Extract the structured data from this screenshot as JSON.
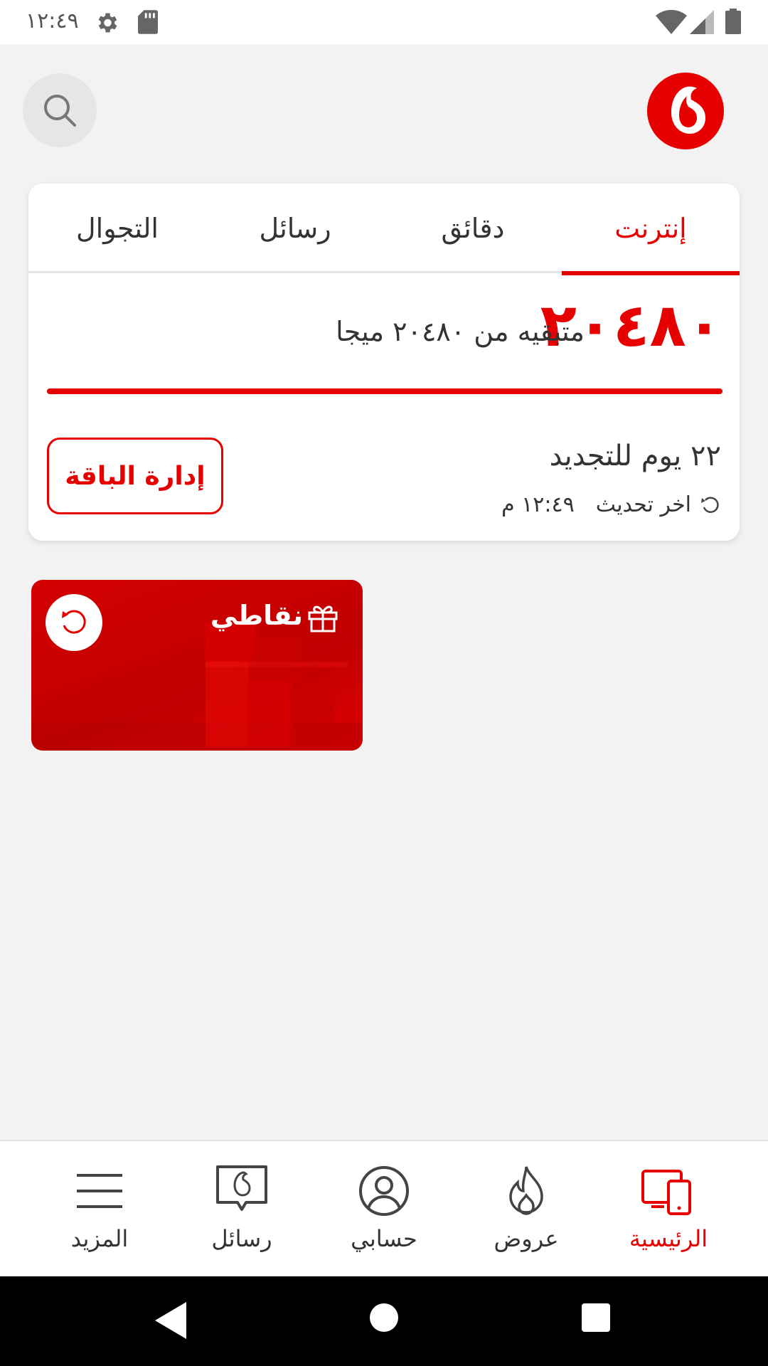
{
  "status_bar": {
    "time": "١٢:٤٩"
  },
  "tabs": [
    {
      "label": "إنترنت",
      "active": true
    },
    {
      "label": "دقائق",
      "active": false
    },
    {
      "label": "رسائل",
      "active": false
    },
    {
      "label": "التجوال",
      "active": false
    }
  ],
  "usage": {
    "remaining": "٢٠٤٨٠",
    "subtitle": "متبقيه من ٢٠٤٨٠ ميجا",
    "progress_fraction": 1.0
  },
  "renewal": {
    "days_text": "٢٢ يوم للتجديد",
    "last_update_label": "اخر تحديث",
    "last_update_time": "١٢:٤٩ م"
  },
  "manage_button": "إدارة الباقة",
  "points_card": {
    "title": "نقاطي"
  },
  "bottom_nav": [
    {
      "label": "الرئيسية",
      "icon": "home-devices-icon",
      "active": true
    },
    {
      "label": "عروض",
      "icon": "flame-icon",
      "active": false
    },
    {
      "label": "حسابي",
      "icon": "account-icon",
      "active": false
    },
    {
      "label": "رسائل",
      "icon": "messages-icon",
      "active": false
    },
    {
      "label": "المزيد",
      "icon": "menu-icon",
      "active": false
    }
  ],
  "colors": {
    "brand_red": "#e60000",
    "background": "#f2f2f2"
  }
}
